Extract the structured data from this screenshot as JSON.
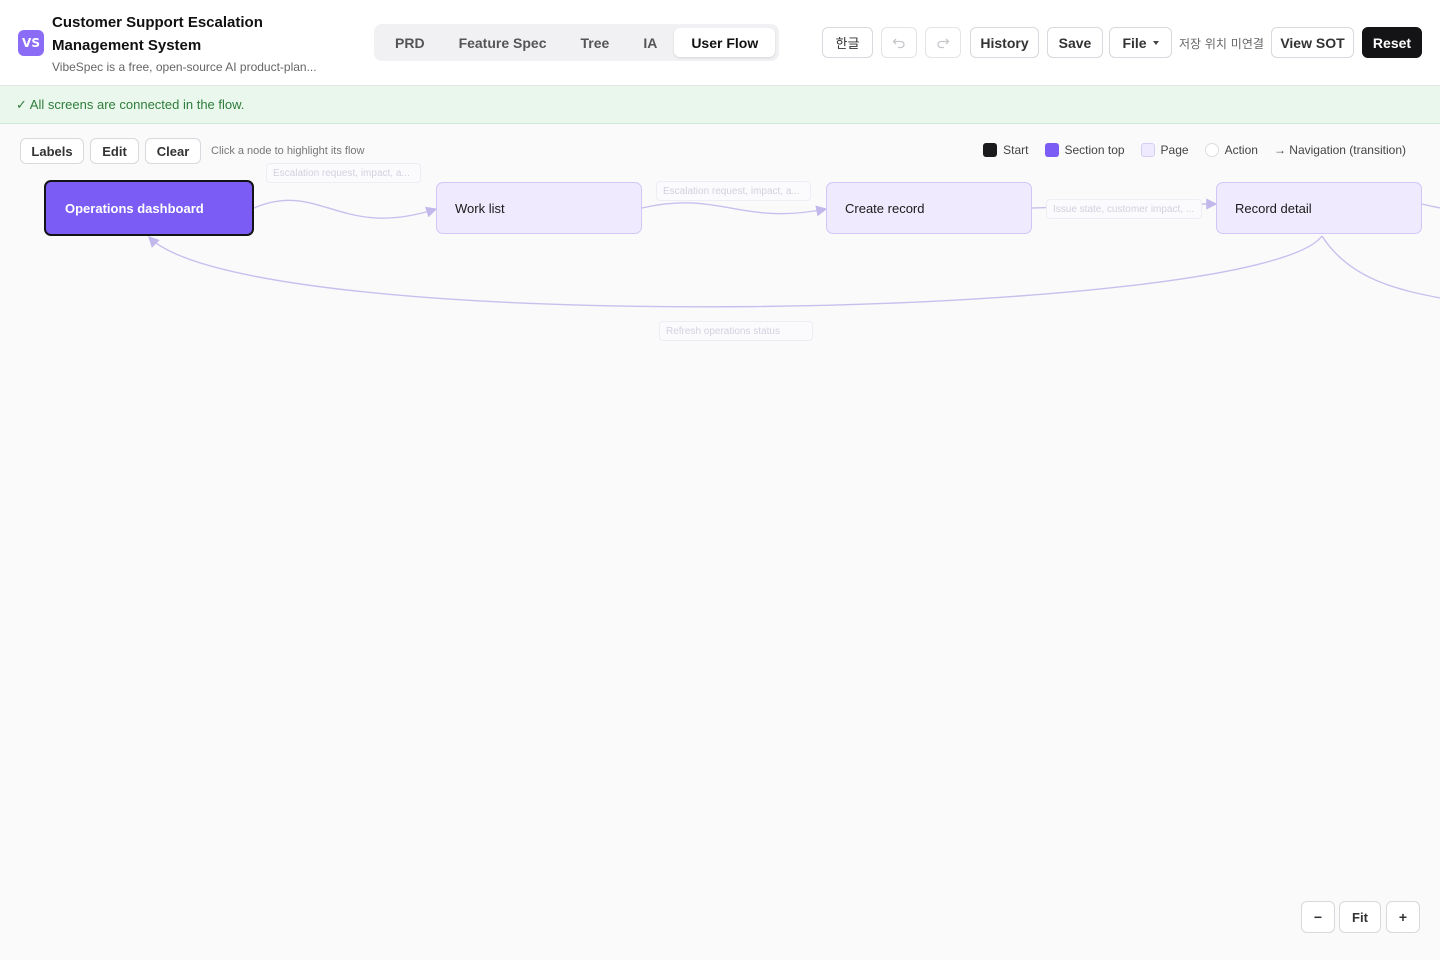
{
  "header": {
    "logo": "VS",
    "title": "Customer Support Escalation Management System",
    "subtitle": "VibeSpec is a free, open-source AI product-plan...",
    "tabs": [
      {
        "label": "PRD",
        "active": false
      },
      {
        "label": "Feature Spec",
        "active": false
      },
      {
        "label": "Tree",
        "active": false
      },
      {
        "label": "IA",
        "active": false
      },
      {
        "label": "User Flow",
        "active": true
      }
    ],
    "lang_label": "한글",
    "undo_icon": "undo-icon",
    "redo_icon": "redo-icon",
    "history_label": "History",
    "save_label": "Save",
    "file_label": "File",
    "save_location_status": "저장 위치 미연결",
    "view_sot_label": "View SOT",
    "reset_label": "Reset"
  },
  "banner": {
    "text": "✓ All screens are connected in the flow."
  },
  "canvas_toolbar": {
    "labels_label": "Labels",
    "edit_label": "Edit",
    "clear_label": "Clear",
    "hint": "Click a node to highlight its flow"
  },
  "legend": {
    "start": "Start",
    "section_top": "Section top",
    "page": "Page",
    "action": "Action",
    "navigation": "→ Navigation (transition)",
    "colors": {
      "start": "#1b1b1d",
      "section_top": "#7b5cf5",
      "page": "#efeafd",
      "action": "#ffffff"
    }
  },
  "flow": {
    "nodes": [
      {
        "label": "Operations dashboard",
        "kind": "section-top"
      },
      {
        "label": "Work list",
        "kind": "page"
      },
      {
        "label": "Create record",
        "kind": "page"
      },
      {
        "label": "Record detail",
        "kind": "page"
      }
    ],
    "edge_labels": [
      "Escalation request, impact, a...",
      "Escalation request, impact, a...",
      "Issue state, customer impact, ...",
      "Refresh operations status"
    ]
  },
  "zoom": {
    "out_label": "−",
    "fit_label": "Fit",
    "in_label": "+"
  }
}
